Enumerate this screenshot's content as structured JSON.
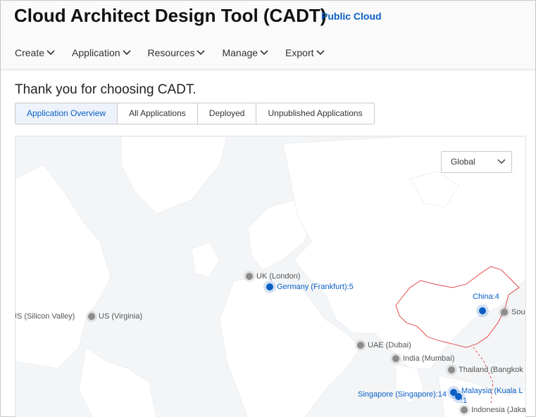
{
  "header": {
    "title": "Cloud Architect Design Tool (CADT)",
    "subtitle": "Public Cloud",
    "menu": [
      "Create",
      "Application",
      "Resources",
      "Manage",
      "Export"
    ]
  },
  "welcome": "Thank you for choosing CADT.",
  "tabs": [
    "Application Overview",
    "All Applications",
    "Deployed",
    "Unpublished Applications"
  ],
  "active_tab": "Application Overview",
  "map": {
    "scope_select": "Global",
    "regions": {
      "us_silicon_valley": "US (Silicon Valley)",
      "us_virginia": "US (Virginia)",
      "uk_london": "UK (London)",
      "germany": "Germany (Frankfurt):5",
      "china": "China:4",
      "south_korea": "Sou",
      "uae": "UAE (Dubai)",
      "india": "India (Mumbai)",
      "thailand": "Thailand (Bangkok",
      "singapore": "Singapore (Singapore):14",
      "malaysia": "Malaysia (Kuala L",
      "malaysia_count": ":1",
      "indonesia": "Indonesia (Jaka"
    }
  },
  "colors": {
    "accent": "#0a5fc4",
    "inactive_dot": "#8c8c8c",
    "map_background": "#f3f5f7",
    "land": "#ffffff",
    "china_border": "#e0393b"
  }
}
